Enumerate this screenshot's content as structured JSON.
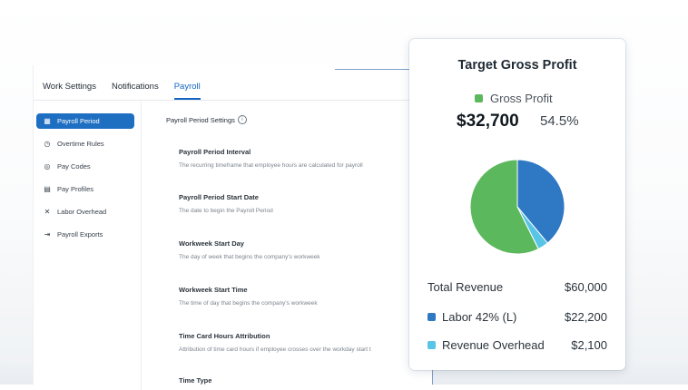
{
  "topnav": {
    "tabs": [
      {
        "label": "Work Settings",
        "active": false
      },
      {
        "label": "Notifications",
        "active": false
      },
      {
        "label": "Payroll",
        "active": true
      }
    ]
  },
  "sidebar": {
    "items": [
      {
        "label": "Payroll Period",
        "icon": "calendar-icon",
        "active": true
      },
      {
        "label": "Overtime Rules",
        "icon": "clock-icon",
        "active": false
      },
      {
        "label": "Pay Codes",
        "icon": "coins-icon",
        "active": false
      },
      {
        "label": "Pay Profiles",
        "icon": "document-icon",
        "active": false
      },
      {
        "label": "Labor Overhead",
        "icon": "tools-icon",
        "active": false
      },
      {
        "label": "Payroll Exports",
        "icon": "export-icon",
        "active": false
      }
    ]
  },
  "content": {
    "section_title": "Payroll Period Settings",
    "settings": [
      {
        "name": "Payroll Period Interval",
        "description": "The recurring timeframe that employee hours are calculated for payroll"
      },
      {
        "name": "Payroll Period Start Date",
        "description": "The date to begin the Payroll Period"
      },
      {
        "name": "Workweek Start Day",
        "description": "The day of week that begins the company's workweek"
      },
      {
        "name": "Workweek Start Time",
        "description": "The time of day that begins the company's workweek"
      },
      {
        "name": "Time Card Hours Attribution",
        "description": "Attribution of time card hours if employee crosses over the workday start t"
      },
      {
        "name": "Time Type",
        "description": ""
      }
    ]
  },
  "card": {
    "title": "Target Gross Profit",
    "legend_label": "Gross Profit",
    "gross_profit_amount": "$32,700",
    "gross_profit_percent": "54.5%",
    "rows": [
      {
        "label": "Total Revenue",
        "value": "$60,000"
      },
      {
        "label": "Labor 42% (L)",
        "value": "$22,200"
      },
      {
        "label": "Revenue Overhead",
        "value": "$2,100"
      }
    ]
  },
  "chart_data": {
    "type": "pie",
    "slices": [
      {
        "name": "Gross Profit",
        "value": 32700,
        "color": "#5cb85c"
      },
      {
        "name": "Labor 42% (L)",
        "value": 22200,
        "color": "#2f78c4"
      },
      {
        "name": "Revenue Overhead",
        "value": 2100,
        "color": "#58c4e6"
      }
    ]
  },
  "colors": {
    "accent": "#1e6ec2",
    "gross_profit": "#5cb85c",
    "labor": "#2f78c4",
    "overhead": "#58c4e6"
  }
}
